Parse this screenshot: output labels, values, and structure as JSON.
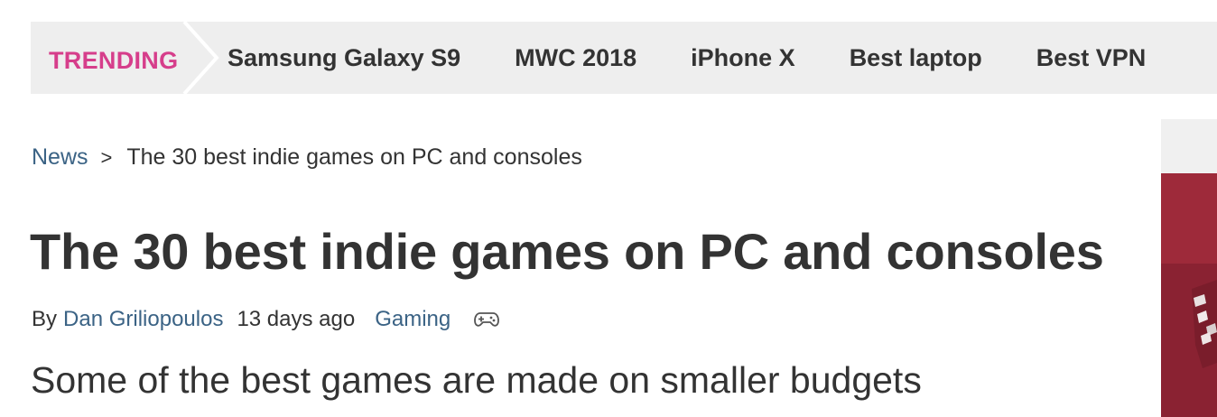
{
  "trending": {
    "label": "TRENDING",
    "links": [
      "Samsung Galaxy S9",
      "MWC 2018",
      "iPhone X",
      "Best laptop",
      "Best VPN"
    ]
  },
  "breadcrumb": {
    "section": "News",
    "separator": ">",
    "current": "The 30 best indie games on PC and consoles"
  },
  "article": {
    "title": "The 30 best indie games on PC and consoles",
    "byline_prefix": "By",
    "author": "Dan Griliopoulos",
    "published": "13 days ago",
    "category": "Gaming",
    "category_icon": "gamepad-icon",
    "strapline": "Some of the best games are made on smaller budgets"
  },
  "colors": {
    "trending_accent": "#d63e8b",
    "link": "#3b6385",
    "text": "#333333",
    "bar_background": "#eeeeee",
    "side_image": "#9e2a3a"
  }
}
